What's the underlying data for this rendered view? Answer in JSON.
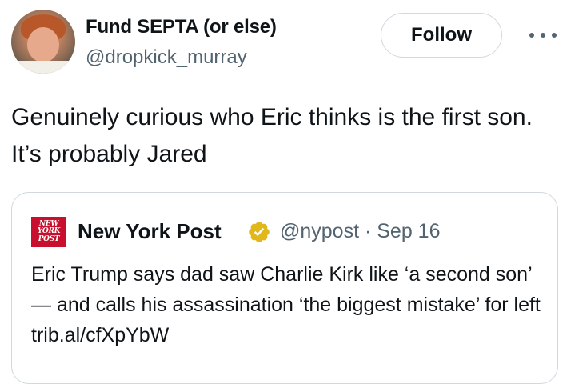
{
  "author": {
    "display_name": "Fund SEPTA (or else)",
    "handle": "@dropkick_murray"
  },
  "actions": {
    "follow_label": "Follow",
    "more_icon": "more-horizontal-icon"
  },
  "tweet": {
    "text": "Genuinely curious who Eric thinks is the first son. It’s probably Jared"
  },
  "quoted_tweet": {
    "logo_lines": [
      "NEW",
      "YORK",
      "POST"
    ],
    "display_name": "New York Post",
    "verified_icon": "verified-badge-gold-icon",
    "handle_date": "@nypost · Sep 16",
    "text": "Eric Trump says dad saw Charlie Kirk like ‘a second son’ — and calls his assassination ‘the biggest mistake’ for left trib.al/cfXpYbW"
  },
  "colors": {
    "text": "#0f1419",
    "secondary": "#536471",
    "border": "#cfd9de",
    "nyp_red": "#c8102e",
    "verified_gold": "#e2b719"
  }
}
